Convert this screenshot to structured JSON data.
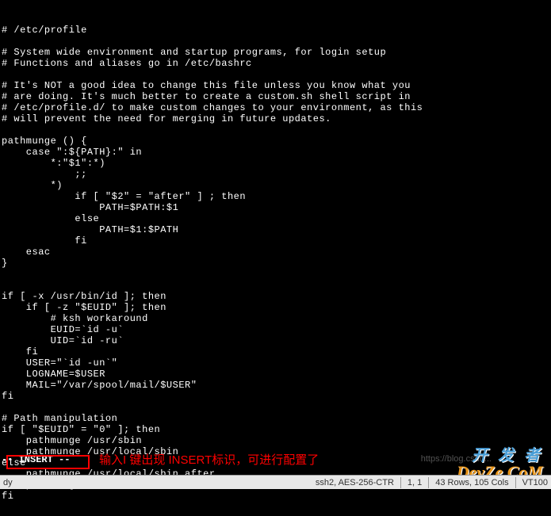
{
  "file": {
    "lines": [
      "# /etc/profile",
      "",
      "# System wide environment and startup programs, for login setup",
      "# Functions and aliases go in /etc/bashrc",
      "",
      "# It's NOT a good idea to change this file unless you know what you",
      "# are doing. It's much better to create a custom.sh shell script in",
      "# /etc/profile.d/ to make custom changes to your environment, as this",
      "# will prevent the need for merging in future updates.",
      "",
      "pathmunge () {",
      "    case \":${PATH}:\" in",
      "        *:\"$1\":*)",
      "            ;;",
      "        *)",
      "            if [ \"$2\" = \"after\" ] ; then",
      "                PATH=$PATH:$1",
      "            else",
      "                PATH=$1:$PATH",
      "            fi",
      "    esac",
      "}",
      "",
      "",
      "if [ -x /usr/bin/id ]; then",
      "    if [ -z \"$EUID\" ]; then",
      "        # ksh workaround",
      "        EUID=`id -u`",
      "        UID=`id -ru`",
      "    fi",
      "    USER=\"`id -un`\"",
      "    LOGNAME=$USER",
      "    MAIL=\"/var/spool/mail/$USER\"",
      "fi",
      "",
      "# Path manipulation",
      "if [ \"$EUID\" = \"0\" ]; then",
      "    pathmunge /usr/sbin",
      "    pathmunge /usr/local/sbin",
      "else",
      "    pathmunge /usr/local/sbin after",
      "    pathmunge /usr/sbin after",
      "fi"
    ]
  },
  "mode_indicator": "-- INSERT --",
  "annotation_text": "输入I 键出现 INSERT标识，可进行配置了",
  "watermark": {
    "line1": "开 发 者",
    "line2": "DevZe.CoM",
    "blog": "https://blog.csdn..."
  },
  "status": {
    "left": "dy",
    "protocol": "ssh2, AES-256-CTR",
    "position": "1, 1",
    "rows_cols": "43 Rows, 105 Cols",
    "vt": "VT100"
  }
}
